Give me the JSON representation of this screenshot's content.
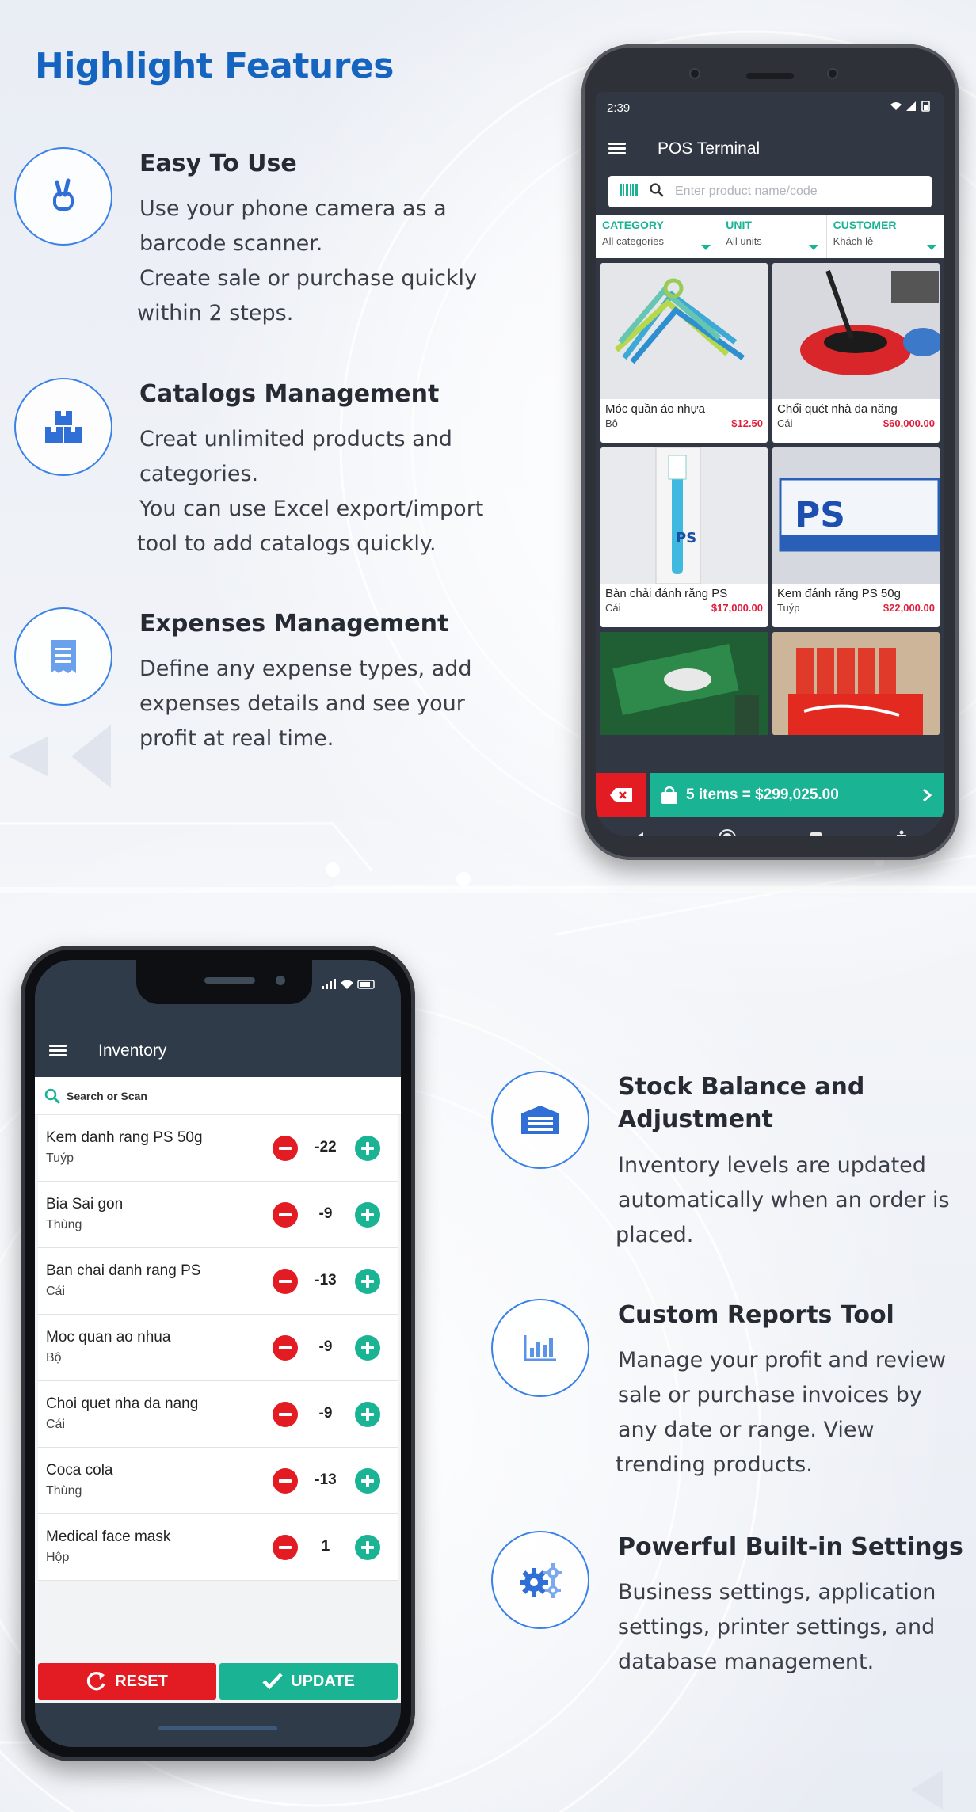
{
  "page": {
    "title": "Highlight Features"
  },
  "features": [
    {
      "icon": "peace-hand-icon",
      "title": "Easy To Use",
      "lines": [
        "Use your phone camera as a",
        "barcode scanner.",
        "Create sale or purchase quickly",
        "within 2 steps."
      ]
    },
    {
      "icon": "boxes-icon",
      "title": "Catalogs Management",
      "lines": [
        "Creat unlimited products and",
        "categories.",
        "You can use Excel export/import",
        "tool to add catalogs quickly."
      ]
    },
    {
      "icon": "receipt-icon",
      "title": "Expenses Management",
      "lines": [
        "Define any expense types, add",
        "expenses details and see your",
        "profit at real time."
      ]
    },
    {
      "icon": "warehouse-icon",
      "title_lines": [
        "Stock Balance and",
        "Adjustment"
      ],
      "lines": [
        "Inventory levels are updated",
        "automatically when an order is",
        "placed."
      ]
    },
    {
      "icon": "bar-chart-icon",
      "title": "Custom Reports Tool",
      "lines": [
        "Manage your profit and review",
        "sale or purchase invoices by",
        "any date or range. View",
        "trending products."
      ]
    },
    {
      "icon": "gears-icon",
      "title": "Powerful Built-in Settings",
      "lines": [
        "Business settings, application",
        "settings, printer settings, and",
        "database management."
      ]
    }
  ],
  "pos": {
    "status_time": "2:39",
    "app_title": "POS Terminal",
    "search_placeholder": "Enter product name/code",
    "filters": [
      {
        "label": "CATEGORY",
        "value": "All categories"
      },
      {
        "label": "UNIT",
        "value": "All units"
      },
      {
        "label": "CUSTOMER",
        "value": "Khách lẻ"
      }
    ],
    "products": [
      {
        "name": "Móc quần áo nhựa",
        "unit": "Bộ",
        "price": "$12.50"
      },
      {
        "name": "Chổi quét nhà đa năng",
        "unit": "Cái",
        "price": "$60,000.00"
      },
      {
        "name": "Bàn chải đánh răng PS",
        "unit": "Cái",
        "price": "$17,000.00"
      },
      {
        "name": "Kem đánh răng PS 50g",
        "unit": "Tuýp",
        "price": "$22,000.00"
      }
    ],
    "cart_summary": "5 items = $299,025.00",
    "colors": {
      "accent": "#1ab394",
      "danger": "#e31b23",
      "appbar": "#323843"
    }
  },
  "inventory": {
    "app_title": "Inventory",
    "search_label": "Search or Scan",
    "items": [
      {
        "name": "Kem danh rang PS 50g",
        "unit": "Tuýp",
        "qty": "-22"
      },
      {
        "name": "Bia Sai gon",
        "unit": "Thùng",
        "qty": "-9"
      },
      {
        "name": "Ban chai danh rang PS",
        "unit": "Cái",
        "qty": "-13"
      },
      {
        "name": "Moc quan ao nhua",
        "unit": "Bộ",
        "qty": "-9"
      },
      {
        "name": "Choi quet nha da nang",
        "unit": "Cái",
        "qty": "-9"
      },
      {
        "name": "Coca cola",
        "unit": "Thùng",
        "qty": "-13"
      },
      {
        "name": "Medical face mask",
        "unit": "Hộp",
        "qty": "1"
      }
    ],
    "reset_label": "RESET",
    "update_label": "UPDATE"
  }
}
